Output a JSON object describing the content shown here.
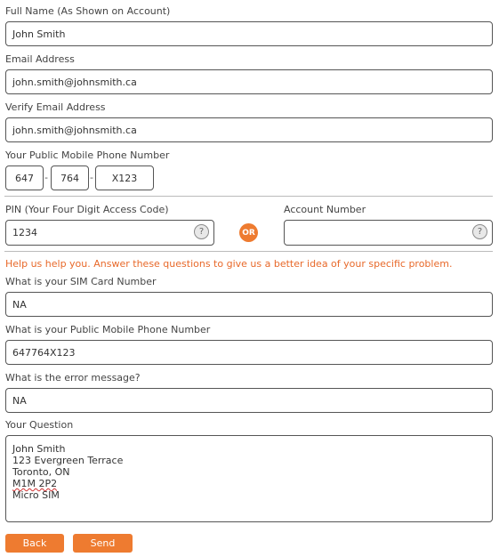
{
  "full_name": {
    "label": "Full Name (As Shown on Account)",
    "value": "John Smith"
  },
  "email": {
    "label": "Email Address",
    "value": "john.smith@johnsmith.ca"
  },
  "verify_email": {
    "label": "Verify Email Address",
    "value": "john.smith@johnsmith.ca"
  },
  "phone": {
    "label": "Your Public Mobile Phone Number",
    "part1": "647",
    "part2": "764",
    "part3": "X123",
    "separator": "-"
  },
  "pin": {
    "label": "PIN (Your Four Digit Access Code)",
    "value": "1234",
    "help_glyph": "?"
  },
  "or_label": "OR",
  "account_number": {
    "label": "Account Number",
    "value": "",
    "help_glyph": "?"
  },
  "help_text": "Help us help you. Answer these questions to give us a better idea of your specific problem.",
  "sim_card": {
    "label": "What is your SIM Card Number",
    "value": "NA"
  },
  "problem_phone": {
    "label": "What is your Public Mobile Phone Number",
    "value": "647764X123"
  },
  "error_message": {
    "label": "What is the error message?",
    "value": "NA"
  },
  "question": {
    "label": "Your Question",
    "lines": [
      "John Smith",
      "123 Evergreen Terrace",
      "Toronto, ON",
      "M1M 2P2",
      "Micro SIM"
    ]
  },
  "buttons": {
    "back": "Back",
    "send": "Send"
  },
  "colors": {
    "accent": "#ee7b30",
    "help_text": "#e8692a",
    "border": "#555555"
  },
  "icons": {
    "help": "question-circle-icon"
  }
}
